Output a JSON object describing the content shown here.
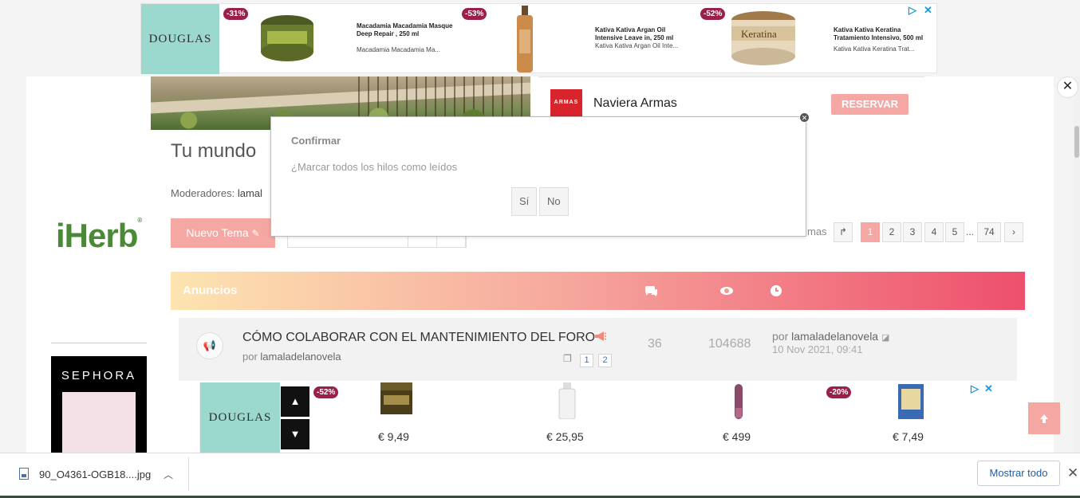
{
  "top_ad": {
    "brand": "DOUGLAS",
    "products": [
      {
        "discount": "-31%",
        "title": "Macadamia Macadamia Masque Deep Repair , 250 ml",
        "subtitle": "Macadamia Macadamia Ma..."
      },
      {
        "discount": "-53%",
        "title": "Kativa Kativa Argan Oil Intensive Leave in, 250 ml",
        "subtitle": "Kativa Kativa Argan Oil Inte..."
      },
      {
        "discount": "-52%",
        "title": "Kativa Kativa Keratina Tratamiento Intensivo, 500 ml",
        "subtitle": "Kativa Kativa Keratina Trat..."
      }
    ],
    "keratina_label": "Keratina"
  },
  "naviera": {
    "logo_text": "ARMAS",
    "name": "Naviera Armas",
    "cta": "RESERVAR"
  },
  "forum": {
    "title": "Tu mundo",
    "moderators_label": "Moderadores:",
    "moderators_value": "lamal",
    "new_topic": "Nuevo Tema",
    "themes_label": "mas",
    "pagination": [
      "1",
      "2",
      "3",
      "4",
      "5",
      "...",
      "74"
    ]
  },
  "announcements": {
    "header": "Anuncios",
    "topic": {
      "title": "CÓMO COLABORAR CON EL MANTENIMIENTO DEL FORO",
      "by": "por",
      "author": "lamaladelanovela",
      "pages": [
        "1",
        "2"
      ],
      "replies": "36",
      "views": "104688",
      "last_by": "por",
      "last_author": "lamaladelanovela",
      "last_date": "10 Nov 2021, 09:41"
    }
  },
  "left_ads": {
    "iherb": "iHerb",
    "sephora": "SEPHORA"
  },
  "bottom_ad": {
    "brand": "DOUGLAS",
    "discounts": [
      "-52%",
      "-20%"
    ],
    "prices": [
      "€ 9,49",
      "€ 25,95",
      "€ 499",
      "€ 7,49"
    ]
  },
  "modal": {
    "title": "Confirmar",
    "message": "¿Marcar todos los hilos como leídos",
    "yes": "Sí",
    "no": "No"
  },
  "download_bar": {
    "file_name": "90_O4361-OGB18....jpg",
    "show_all": "Mostrar todo"
  },
  "colors": {
    "accent": "#f4a7a3",
    "douglas": "#9bd9ce",
    "discount": "#9b1f4b",
    "gradient_start": "#fde4b0",
    "gradient_end": "#ee4f6c"
  }
}
